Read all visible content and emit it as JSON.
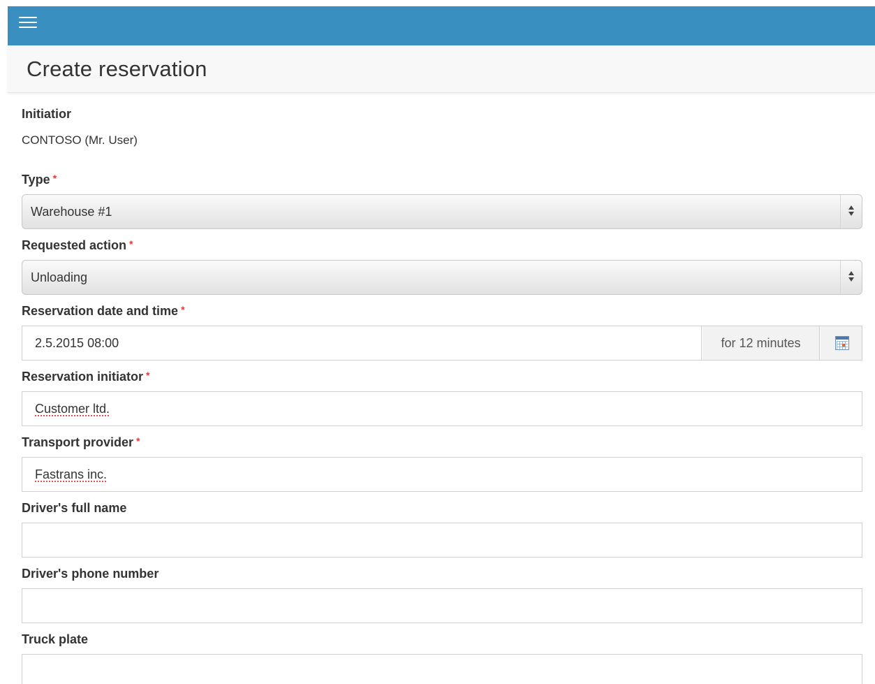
{
  "header": {
    "menu_icon": "hamburger-menu-icon",
    "color": "#3a8fc1"
  },
  "page": {
    "title": "Create reservation"
  },
  "form": {
    "initiator": {
      "label": "Initiatior",
      "value": "CONTOSO (Mr. User)"
    },
    "type": {
      "label": "Type",
      "required": "*",
      "value": "Warehouse #1"
    },
    "requested_action": {
      "label": "Requested action",
      "required": "*",
      "value": "Unloading"
    },
    "reservation_datetime": {
      "label": "Reservation date and time",
      "required": "*",
      "value": "2.5.2015 08:00",
      "duration": "for 12 minutes",
      "calendar_icon": "calendar-icon"
    },
    "reservation_initiator": {
      "label": "Reservation initiator",
      "required": "*",
      "value": "Customer ltd."
    },
    "transport_provider": {
      "label": "Transport provider",
      "required": "*",
      "value": "Fastrans inc."
    },
    "driver_full_name": {
      "label": "Driver's full name",
      "value": ""
    },
    "driver_phone": {
      "label": "Driver's phone number",
      "value": ""
    },
    "truck_plate": {
      "label": "Truck plate",
      "value": ""
    }
  },
  "colors": {
    "accent": "#3a8fc1",
    "required": "#e03a3a"
  }
}
